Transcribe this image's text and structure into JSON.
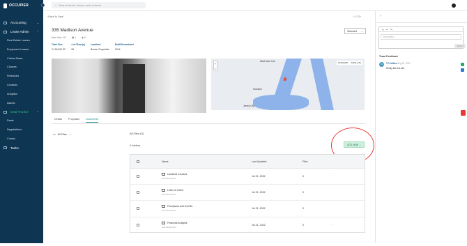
{
  "app": {
    "name": "OCCUPIER"
  },
  "search": {
    "placeholder": "Search deals, leases and contacts"
  },
  "sidebar": {
    "accounting": "Accounting",
    "lease_admin": "Lease Admin",
    "lease_admin_items": [
      "Real Estate Leases",
      "Equipment Leases",
      "Critical Dates",
      "Clauses",
      "Financials",
      "Contacts",
      "Analytics",
      "Assets"
    ],
    "deal_tracker": "Deal Tracker",
    "deal_tracker_items": [
      "Deals",
      "Negotiations",
      "Comps"
    ],
    "tasks": "Tasks"
  },
  "header": {
    "back": "‹  Back to Deal",
    "pager": "‹   1 / 3   ›",
    "title": "335 Madison Avenue",
    "more": "···",
    "status": "Selected"
  },
  "address": {
    "city": "New York, NY",
    "count1": "1",
    "count2": "6"
  },
  "meta": [
    {
      "label": "Total Size",
      "value": "2,100,000 SF"
    },
    {
      "label": "# of Floor(s)",
      "value": "55"
    },
    {
      "label": "Landlord",
      "value": "Boston Properties"
    },
    {
      "label": "Built/Remodeled",
      "value": "2014"
    }
  ],
  "map": {
    "zoom_in": "+",
    "zoom_out": "−",
    "type_map": "ROADMAP",
    "type_sat": "SATELLITE",
    "labels": [
      "West New York",
      "Hoboken",
      "Jersey City"
    ]
  },
  "tabs": [
    "Details",
    "Proposals",
    "Documents"
  ],
  "files": {
    "filter": "All Files",
    "heading": "All Files (3)",
    "folders_count": "4 folders",
    "add_label": "ADD NEW",
    "columns": {
      "name": "Name",
      "updated": "Last Updated",
      "files": "Files"
    },
    "rows": [
      {
        "name": "Landlord Courses",
        "desc": "Add description",
        "updated": "Jul 21, 2022",
        "files": "0"
      },
      {
        "name": "Letter of intent",
        "desc": "Add description",
        "updated": "Jul 21, 2022",
        "files": "0"
      },
      {
        "name": "Floorplans and test fits",
        "desc": "Add description",
        "updated": "Jul 21, 2022",
        "files": "0"
      },
      {
        "name": "Financial Analysis",
        "desc": "Add description",
        "updated": "Jul 21, 2022",
        "files": "0"
      }
    ]
  },
  "right_panel": {
    "description_placeholder": "Description...",
    "submit": "Submit",
    "feedback_title": "Team Feedback",
    "feedback": [
      {
        "author": "TJ Collins",
        "date": "Aug 23, 2021",
        "text": "Really like this site",
        "initials": "TC"
      }
    ]
  },
  "colors": {
    "sidebar": "#0e3552",
    "accent": "#33c27f",
    "ring": "#e53935"
  }
}
